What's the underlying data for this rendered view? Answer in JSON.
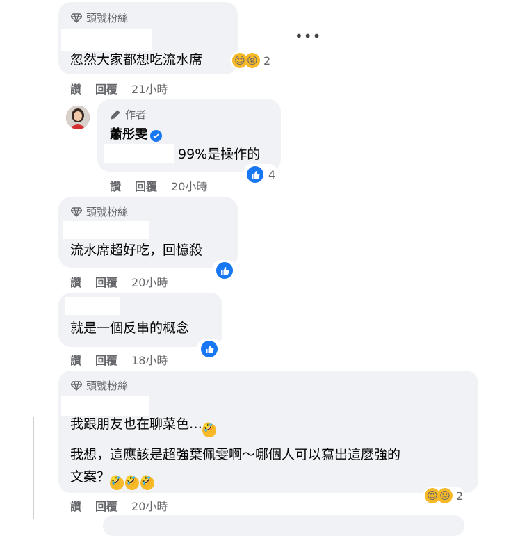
{
  "badges": {
    "top_fan": "頭號粉絲",
    "author": "作者"
  },
  "actions": {
    "like": "讚",
    "reply": "回覆"
  },
  "comments": [
    {
      "text": "忽然大家都想吃流水席",
      "time": "21小時",
      "reaction_count": "2"
    },
    {
      "author_name": "蕭彤雯",
      "text": "99%是操作的",
      "time": "20小時",
      "reaction_count": "4"
    },
    {
      "text": "流水席超好吃，回憶殺",
      "time": "20小時"
    },
    {
      "text": "就是一個反串的概念",
      "time": "18小時"
    },
    {
      "line1": "我跟朋友也在聊菜色…",
      "line2": "我想，這應該是超強葉佩雯啊～哪個人可以寫出這麼強的",
      "line3": "文案？",
      "time": "20小時",
      "reaction_count": "2"
    }
  ],
  "more_label": "•••",
  "icons": [
    "diamond-icon",
    "pencil-icon",
    "verified-icon",
    "like-icon",
    "haha-icon",
    "care-icon"
  ],
  "colors": {
    "bubble": "#f0f2f5",
    "like_blue": "#1877f2",
    "meta_gray": "#65676b"
  }
}
